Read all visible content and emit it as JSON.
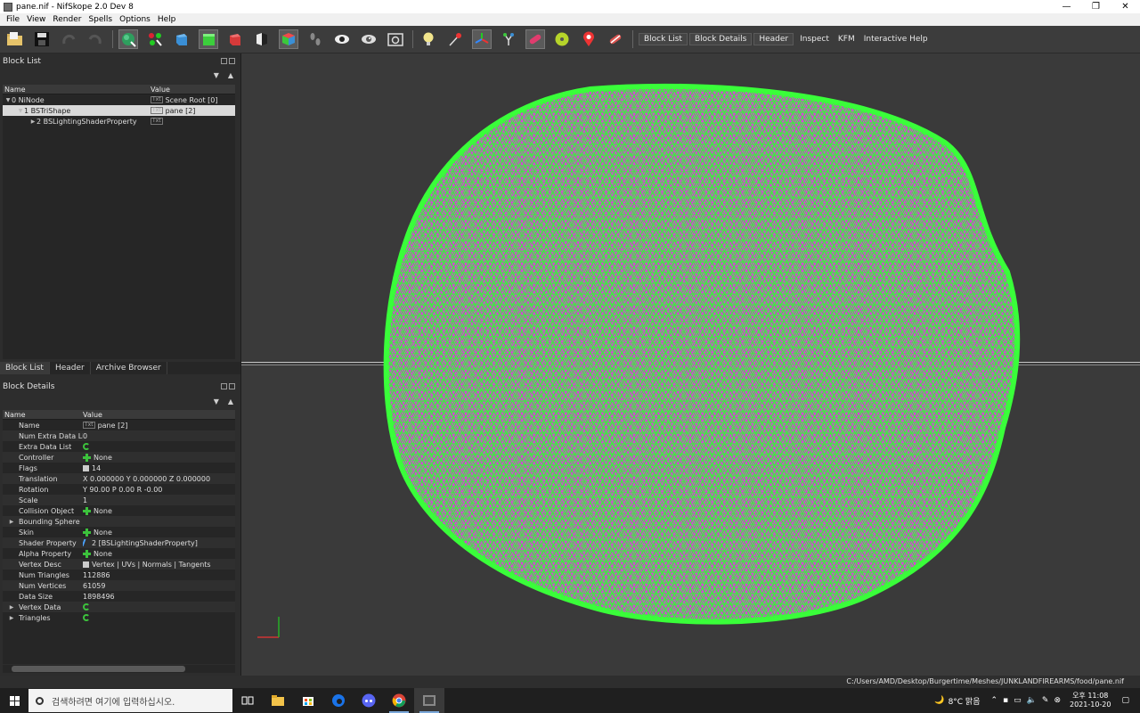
{
  "window": {
    "title": "pane.nif - NifSkope 2.0 Dev 8",
    "controls": [
      "—",
      "❐",
      "✕"
    ]
  },
  "menu": [
    "File",
    "View",
    "Render",
    "Spells",
    "Options",
    "Help"
  ],
  "toolbar": {
    "text_buttons": [
      "Block List",
      "Block Details",
      "Header",
      "Inspect",
      "KFM",
      "Interactive Help"
    ]
  },
  "block_list": {
    "title": "Block List",
    "columns": [
      "Name",
      "Value"
    ],
    "rows": [
      {
        "name": "0 NiNode",
        "value": "Scene Root [0]",
        "expander": "▼",
        "indent": 0
      },
      {
        "name": "1 BSTriShape",
        "value": "pane [2]",
        "expander": "▼",
        "indent": 1,
        "selected": true
      },
      {
        "name": "2 BSLightingShaderProperty",
        "value": "",
        "expander": "▶",
        "indent": 2
      }
    ],
    "tag_label": "Txt"
  },
  "tabs": [
    "Block List",
    "Header",
    "Archive Browser"
  ],
  "block_details": {
    "title": "Block Details",
    "columns": [
      "Name",
      "Value"
    ],
    "rows": [
      {
        "name": "Name",
        "value": "pane [2]",
        "icon": "txt"
      },
      {
        "name": "Num Extra Data List",
        "value": "0",
        "icon": ""
      },
      {
        "name": "Extra Data List",
        "value": "",
        "icon": "cycle"
      },
      {
        "name": "Controller",
        "value": "None",
        "icon": "plus"
      },
      {
        "name": "Flags",
        "value": "14",
        "icon": "flag"
      },
      {
        "name": "Translation",
        "value": "X 0.000000 Y 0.000000 Z 0.000000",
        "icon": ""
      },
      {
        "name": "Rotation",
        "value": "Y 90.00 P 0.00 R -0.00",
        "icon": ""
      },
      {
        "name": "Scale",
        "value": "1",
        "icon": ""
      },
      {
        "name": "Collision Object",
        "value": "None",
        "icon": "plus"
      },
      {
        "name": "Bounding Sphere",
        "value": "",
        "icon": "",
        "expander": "▶"
      },
      {
        "name": "Skin",
        "value": "None",
        "icon": "plus"
      },
      {
        "name": "Shader Property",
        "value": "2 [BSLightingShaderProperty]",
        "icon": "link"
      },
      {
        "name": "Alpha Property",
        "value": "None",
        "icon": "plus"
      },
      {
        "name": "Vertex Desc",
        "value": "Vertex | UVs | Normals | Tangents",
        "icon": "flag"
      },
      {
        "name": "Num Triangles",
        "value": "112886",
        "icon": ""
      },
      {
        "name": "Num Vertices",
        "value": "61059",
        "icon": ""
      },
      {
        "name": "Data Size",
        "value": "1898496",
        "icon": ""
      },
      {
        "name": "Vertex Data",
        "value": "",
        "icon": "cycle",
        "expander": "▶"
      },
      {
        "name": "Triangles",
        "value": "",
        "icon": "cycle",
        "expander": "▶"
      }
    ]
  },
  "status": {
    "path": "C:/Users/AMD/Desktop/Burgertime/Meshes/JUNKLANDFIREARMS/food/pane.nif"
  },
  "taskbar": {
    "search_placeholder": "검색하려면 여기에 입력하십시오.",
    "weather": "8°C 맑음",
    "time": "오후 11:08",
    "date": "2021-10-20"
  },
  "colors": {
    "wire": "#33ff33",
    "face": "#e040e0",
    "viewport_bg": "#3a3a3a"
  }
}
